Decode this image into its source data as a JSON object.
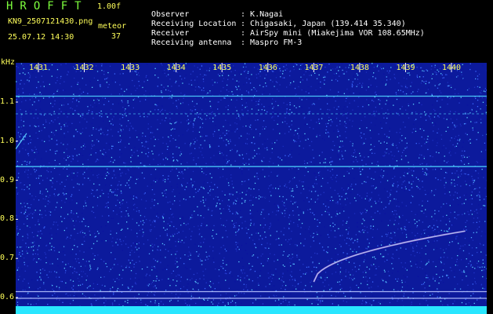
{
  "header": {
    "title": "HROFFT",
    "version": "1.00f",
    "filename": "KN9_2507121430.png",
    "timestamp": "25.07.12 14:30",
    "meteor_label": "meteor",
    "meteor_count": "37"
  },
  "info": [
    {
      "label": "Observer",
      "value": "K.Nagai"
    },
    {
      "label": "Receiving Location",
      "value": "Chigasaki, Japan (139.414 35.340)"
    },
    {
      "label": "Receiver",
      "value": "AirSpy mini (Miakejima VOR 108.65MHz)"
    },
    {
      "label": "Receiving antenna",
      "value": "Maspro FM-3"
    }
  ],
  "colors": {
    "background": "#000000",
    "spectrogram_bg": "#0c1a9c",
    "label_yellow": "#ffff5a",
    "title_green": "#7dff3d",
    "carrier_line": "#4fd6ff",
    "bottom_band": "#29e6ff"
  },
  "chart_data": {
    "type": "heatmap",
    "title": "",
    "xlabel": "",
    "ylabel": "kHz",
    "x_ticks": [
      "1431",
      "1432",
      "1433",
      "1434",
      "1435",
      "1436",
      "1437",
      "1438",
      "1439",
      "1440"
    ],
    "y_ticks": [
      "1.1",
      "1.0",
      "0.9",
      "0.8",
      "0.7",
      "0.6"
    ],
    "ylim": [
      0.58,
      1.2
    ],
    "y_unit_label": "kHz",
    "horizontal_lines_khz": [
      1.115,
      1.07,
      0.935,
      0.615,
      0.598
    ],
    "meteor_echo": {
      "time_start": 1437.0,
      "time_end": 1440.3,
      "freq_start_khz": 0.64,
      "freq_end_khz": 0.77
    }
  }
}
